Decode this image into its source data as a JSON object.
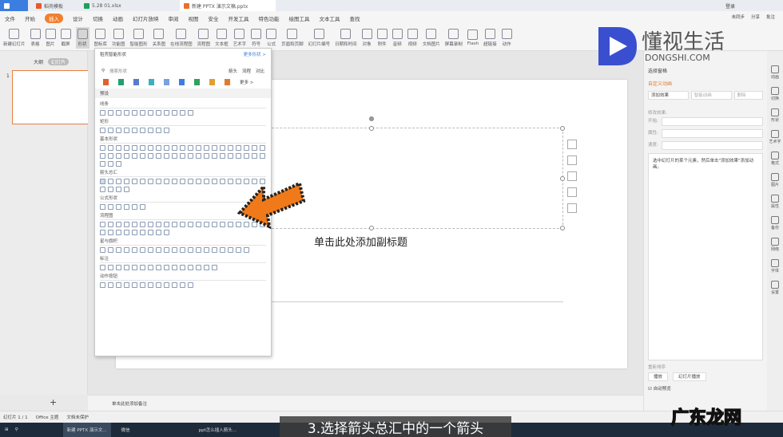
{
  "tabs": [
    {
      "label": "",
      "color": "#3c7de0"
    },
    {
      "label": "稻壳模板",
      "color": "#e8582a"
    },
    {
      "label": "5.28 01.xlsx",
      "color": "#1f9e5a"
    },
    {
      "label": "新建 PPTX 演示文稿.pptx",
      "color": "#e8702a"
    }
  ],
  "user": "登录",
  "menu": [
    "文件",
    "开始",
    "插入",
    "设计",
    "切换",
    "动画",
    "幻灯片放映",
    "审阅",
    "视图",
    "安全",
    "开发工具",
    "特色功能",
    "绘图工具",
    "文本工具",
    "查找"
  ],
  "menu_active": "插入",
  "menu_right": [
    "未同步",
    "分享",
    "批注"
  ],
  "ribbon": [
    "新建幻灯片",
    "表格",
    "图片",
    "截屏",
    "形状",
    "图标库",
    "功能图",
    "智能图形",
    "关系图",
    "在线流程图",
    "流程图",
    "文本框",
    "艺术字",
    "符号",
    "公式",
    "页眉和页脚",
    "幻灯片编号",
    "日期和时间",
    "对象",
    "附件",
    "音频",
    "视频",
    "文档图片",
    "屏幕录制",
    "Flash",
    "超链接",
    "动作"
  ],
  "left": {
    "tab1": "大纲",
    "tab2": "幻灯片",
    "slide_no": "1"
  },
  "slide": {
    "subtitle": "单击此处添加副标题"
  },
  "shapes": {
    "title": "稻壳智能形状",
    "more": "更多形状 >",
    "search": "搜索形状",
    "chips": [
      "箭头",
      "流程",
      "对比"
    ],
    "more2": "更多 >",
    "preset": "预设",
    "sections": [
      "线条",
      "矩形",
      "基本形状",
      "箭头总汇",
      "公式形状",
      "流程图",
      "星与旗帜",
      "标注",
      "动作按钮"
    ]
  },
  "rpanel": {
    "pane": "选择窗格",
    "title": "自定义动画",
    "add": "添加效果",
    "smart": "智能动画",
    "del": "删除",
    "modify": "修改效果:",
    "start": "开始:",
    "prop": "属性:",
    "speed": "速度:",
    "hint": "选中幻灯片的某个元素，然后单击\"添加效果\"添加动画。",
    "reorder": "重新排序",
    "play": "播放",
    "slideplay": "幻灯片播放",
    "autopreview": "自动预览"
  },
  "ricons": [
    "动画",
    "切换",
    "形状",
    "艺术字",
    "格式",
    "图片",
    "属性",
    "备份",
    "网络",
    "字体",
    "设置"
  ],
  "notes": "单击此处添加备注",
  "status": [
    "幻灯片 1 / 1",
    "Office 主题",
    "文档未保护"
  ],
  "taskbar": [
    "新建 PPTX 演示文...",
    "微信",
    "ppt怎么插入箭头..."
  ],
  "caption": "3.选择箭头总汇中的一个箭头",
  "watermark": {
    "text": "懂视生活",
    "url": "DONGSHI.COM",
    "text2": "广东龙网"
  },
  "colors": {
    "accent": "#f08030",
    "arrow": "#f07a1a"
  }
}
